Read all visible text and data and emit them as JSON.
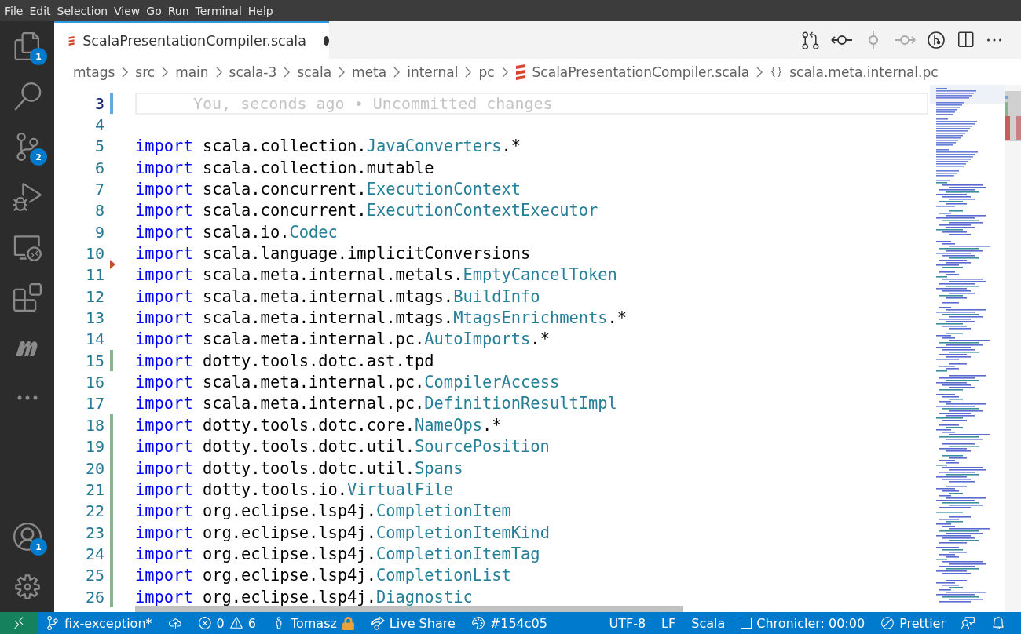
{
  "menu": [
    "File",
    "Edit",
    "Selection",
    "View",
    "Go",
    "Run",
    "Terminal",
    "Help"
  ],
  "activity_bar": [
    {
      "kind": "files",
      "badge": "1"
    },
    {
      "kind": "search"
    },
    {
      "kind": "source-control",
      "badge": "2"
    },
    {
      "kind": "debug"
    },
    {
      "kind": "remote"
    },
    {
      "kind": "extensions"
    },
    {
      "kind": "metals"
    },
    {
      "kind": "more"
    }
  ],
  "activity_bottom": [
    {
      "kind": "account",
      "badge": "1"
    },
    {
      "kind": "settings"
    }
  ],
  "tab": {
    "title": "ScalaPresentationCompiler.scala",
    "dirty": true,
    "selected": true
  },
  "editor_actions": [
    {
      "kind": "compare",
      "disabled": false
    },
    {
      "kind": "previous",
      "disabled": false
    },
    {
      "kind": "commit",
      "disabled": true
    },
    {
      "kind": "next",
      "disabled": true
    },
    {
      "kind": "lens",
      "disabled": false
    },
    {
      "kind": "split",
      "disabled": false
    },
    {
      "kind": "more",
      "disabled": false
    }
  ],
  "breadcrumbs": [
    {
      "label": "mtags",
      "kind": "folder"
    },
    {
      "label": "src",
      "kind": "folder"
    },
    {
      "label": "main",
      "kind": "folder"
    },
    {
      "label": "scala-3",
      "kind": "folder"
    },
    {
      "label": "scala",
      "kind": "folder"
    },
    {
      "label": "meta",
      "kind": "folder"
    },
    {
      "label": "internal",
      "kind": "folder"
    },
    {
      "label": "pc",
      "kind": "folder"
    },
    {
      "label": "ScalaPresentationCompiler.scala",
      "kind": "file"
    },
    {
      "label": "scala.meta.internal.pc",
      "kind": "namespace"
    }
  ],
  "lines": [
    {
      "number": "3",
      "current": true,
      "modified": true,
      "added": false,
      "deleted_above": false,
      "annotation": "You, seconds ago • Uncommitted changes"
    },
    {
      "number": "4",
      "current": false,
      "modified": false,
      "added": false,
      "deleted_above": false
    },
    {
      "number": "5",
      "current": false,
      "modified": false,
      "added": false,
      "deleted_above": false,
      "keyword": "import",
      "package": "scala.collection.",
      "name": "JavaConverters",
      "suffix": ".*"
    },
    {
      "number": "6",
      "current": false,
      "modified": false,
      "added": false,
      "deleted_above": false,
      "keyword": "import",
      "package": "scala.collection.mutable"
    },
    {
      "number": "7",
      "current": false,
      "modified": false,
      "added": false,
      "deleted_above": false,
      "keyword": "import",
      "package": "scala.concurrent.",
      "name": "ExecutionContext"
    },
    {
      "number": "8",
      "current": false,
      "modified": false,
      "added": false,
      "deleted_above": false,
      "keyword": "import",
      "package": "scala.concurrent.",
      "name": "ExecutionContextExecutor"
    },
    {
      "number": "9",
      "current": false,
      "modified": false,
      "added": false,
      "deleted_above": false,
      "keyword": "import",
      "package": "scala.io.",
      "name": "Codec"
    },
    {
      "number": "10",
      "current": false,
      "modified": false,
      "added": false,
      "deleted_above": false,
      "keyword": "import",
      "package": "scala.language.implicitConversions"
    },
    {
      "number": "11",
      "current": false,
      "modified": false,
      "added": false,
      "deleted_above": true,
      "keyword": "import",
      "package": "scala.meta.internal.metals.",
      "name": "EmptyCancelToken"
    },
    {
      "number": "12",
      "current": false,
      "modified": false,
      "added": false,
      "deleted_above": false,
      "keyword": "import",
      "package": "scala.meta.internal.mtags.",
      "name": "BuildInfo"
    },
    {
      "number": "13",
      "current": false,
      "modified": false,
      "added": false,
      "deleted_above": false,
      "keyword": "import",
      "package": "scala.meta.internal.mtags.",
      "name": "MtagsEnrichments",
      "suffix": ".*"
    },
    {
      "number": "14",
      "current": false,
      "modified": false,
      "added": false,
      "deleted_above": false,
      "keyword": "import",
      "package": "scala.meta.internal.pc.",
      "name": "AutoImports",
      "suffix": ".*"
    },
    {
      "number": "15",
      "current": false,
      "modified": false,
      "added": true,
      "deleted_above": false,
      "keyword": "import",
      "package": "dotty.tools.dotc.ast.tpd"
    },
    {
      "number": "16",
      "current": false,
      "modified": false,
      "added": false,
      "deleted_above": false,
      "keyword": "import",
      "package": "scala.meta.internal.pc.",
      "name": "CompilerAccess"
    },
    {
      "number": "17",
      "current": false,
      "modified": false,
      "added": false,
      "deleted_above": false,
      "keyword": "import",
      "package": "scala.meta.internal.pc.",
      "name": "DefinitionResultImpl"
    },
    {
      "number": "18",
      "current": false,
      "modified": false,
      "added": true,
      "deleted_above": false,
      "keyword": "import",
      "package": "dotty.tools.dotc.core.",
      "name": "NameOps",
      "suffix": ".*"
    },
    {
      "number": "19",
      "current": false,
      "modified": false,
      "added": true,
      "deleted_above": false,
      "keyword": "import",
      "package": "dotty.tools.dotc.util.",
      "name": "SourcePosition"
    },
    {
      "number": "20",
      "current": false,
      "modified": false,
      "added": true,
      "deleted_above": false,
      "keyword": "import",
      "package": "dotty.tools.dotc.util.",
      "name": "Spans"
    },
    {
      "number": "21",
      "current": false,
      "modified": false,
      "added": true,
      "deleted_above": false,
      "keyword": "import",
      "package": "dotty.tools.io.",
      "name": "VirtualFile"
    },
    {
      "number": "22",
      "current": false,
      "modified": false,
      "added": true,
      "deleted_above": false,
      "keyword": "import",
      "package": "org.eclipse.lsp4j.",
      "name": "CompletionItem"
    },
    {
      "number": "23",
      "current": false,
      "modified": false,
      "added": true,
      "deleted_above": false,
      "keyword": "import",
      "package": "org.eclipse.lsp4j.",
      "name": "CompletionItemKind"
    },
    {
      "number": "24",
      "current": false,
      "modified": false,
      "added": true,
      "deleted_above": false,
      "keyword": "import",
      "package": "org.eclipse.lsp4j.",
      "name": "CompletionItemTag"
    },
    {
      "number": "25",
      "current": false,
      "modified": false,
      "added": true,
      "deleted_above": false,
      "keyword": "import",
      "package": "org.eclipse.lsp4j.",
      "name": "CompletionList"
    },
    {
      "number": "26",
      "current": false,
      "modified": false,
      "added": true,
      "deleted_above": false,
      "keyword": "import",
      "package": "org.eclipse.lsp4j.",
      "name": "Diagnostic"
    }
  ],
  "status_bar": [
    {
      "kind": "branch",
      "text": "fix-exception*"
    },
    {
      "kind": "sync"
    },
    {
      "kind": "problems",
      "errors": "0",
      "warnings": "6"
    },
    {
      "kind": "user",
      "text": "Tomasz"
    },
    {
      "kind": "liveshare",
      "text": "Live Share"
    },
    {
      "kind": "color",
      "text": "#154c05"
    },
    {
      "kind": "plain",
      "text": "UTF-8"
    },
    {
      "kind": "plain",
      "text": "LF"
    },
    {
      "kind": "plain",
      "text": "Scala"
    },
    {
      "kind": "chronicler",
      "text": "Chronicler: 00:00"
    },
    {
      "kind": "prettier",
      "text": "Prettier"
    },
    {
      "kind": "feedback"
    },
    {
      "kind": "bell"
    }
  ]
}
